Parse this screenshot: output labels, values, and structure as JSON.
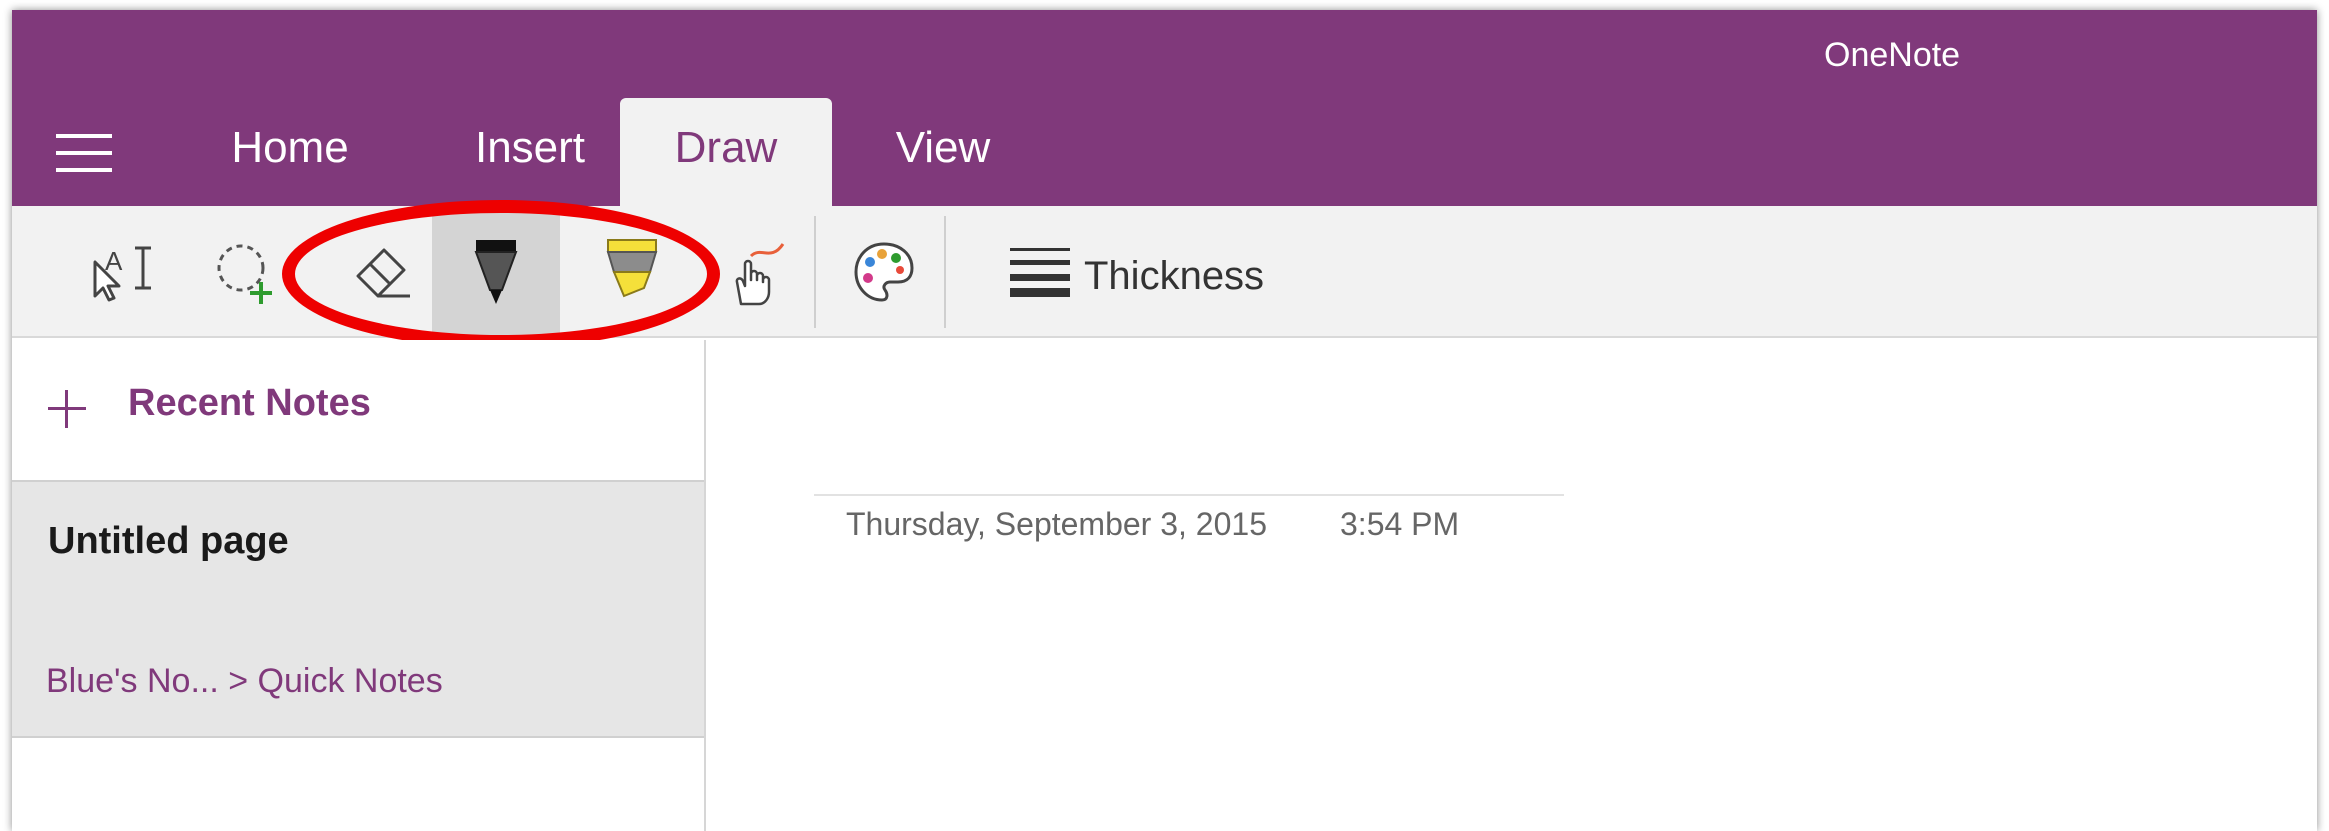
{
  "app": {
    "title": "OneNote",
    "accent_color": "#80397b"
  },
  "tabs": [
    {
      "label": "Home",
      "active": false
    },
    {
      "label": "Insert",
      "active": false
    },
    {
      "label": "Draw",
      "active": true
    },
    {
      "label": "View",
      "active": false
    }
  ],
  "ribbon": {
    "tools": [
      {
        "icon": "type-select-icon",
        "selected": false
      },
      {
        "icon": "lasso-select-icon",
        "selected": false
      },
      {
        "icon": "eraser-icon",
        "selected": false
      },
      {
        "icon": "pen-icon",
        "selected": true
      },
      {
        "icon": "highlighter-icon",
        "selected": false
      },
      {
        "icon": "draw-with-touch-icon",
        "selected": false
      },
      {
        "icon": "color-palette-icon",
        "selected": false
      },
      {
        "icon": "thickness-icon",
        "selected": false
      }
    ],
    "thickness_label": "Thickness"
  },
  "annotation": {
    "color": "#ee0000",
    "shape": "ellipse"
  },
  "left_pane": {
    "recent_notes_label": "Recent Notes",
    "pages": [
      {
        "title": "Untitled page",
        "location": "Blue's No... > Quick Notes"
      }
    ]
  },
  "page": {
    "date": "Thursday, September 3, 2015",
    "time": "3:54 PM"
  }
}
